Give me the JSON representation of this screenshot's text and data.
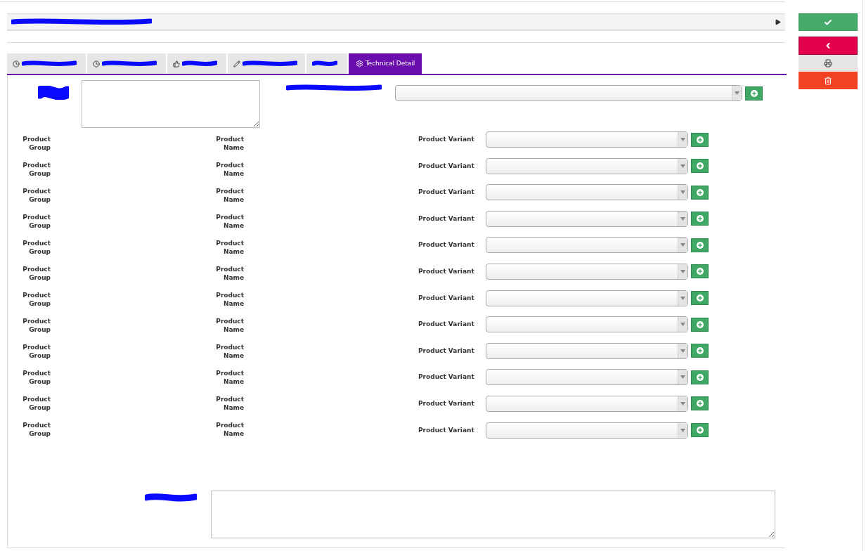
{
  "section_header": {
    "expanded": false
  },
  "tabs": [
    {
      "kind": "clock",
      "selected": false
    },
    {
      "kind": "clock",
      "selected": false
    },
    {
      "kind": "thumb",
      "selected": false
    },
    {
      "kind": "pencil",
      "selected": false
    },
    {
      "kind": "none",
      "selected": false
    },
    {
      "kind": "gear",
      "label": "Technical Detail",
      "selected": true
    }
  ],
  "group_labels": [
    {
      "line1": "Product",
      "line2": "Group"
    },
    {
      "line1": "Product",
      "line2": "Group"
    },
    {
      "line1": "Product",
      "line2": "Group"
    },
    {
      "line1": "Product",
      "line2": "Group"
    },
    {
      "line1": "Product",
      "line2": "Group"
    },
    {
      "line1": "Product",
      "line2": "Group"
    },
    {
      "line1": "Product",
      "line2": "Group"
    },
    {
      "line1": "Product",
      "line2": "Group"
    },
    {
      "line1": "Product",
      "line2": "Group"
    },
    {
      "line1": "Product",
      "line2": "Group"
    },
    {
      "line1": "Product",
      "line2": "Group"
    },
    {
      "line1": "Product",
      "line2": "Group"
    }
  ],
  "name_labels": [
    {
      "line1": "Product",
      "line2": "Name"
    },
    {
      "line1": "Product",
      "line2": "Name"
    },
    {
      "line1": "Product",
      "line2": "Name"
    },
    {
      "line1": "Product",
      "line2": "Name"
    },
    {
      "line1": "Product",
      "line2": "Name"
    },
    {
      "line1": "Product",
      "line2": "Name"
    },
    {
      "line1": "Product",
      "line2": "Name"
    },
    {
      "line1": "Product",
      "line2": "Name"
    },
    {
      "line1": "Product",
      "line2": "Name"
    },
    {
      "line1": "Product",
      "line2": "Name"
    },
    {
      "line1": "Product",
      "line2": "Name"
    },
    {
      "line1": "Product",
      "line2": "Name"
    }
  ],
  "variants": [
    "Product Variant",
    "Product Variant",
    "Product Variant",
    "Product Variant",
    "Product Variant",
    "Product Variant",
    "Product Variant",
    "Product Variant",
    "Product Variant",
    "Product Variant",
    "Product Variant",
    "Product Variant"
  ],
  "actions": [
    {
      "kind": "save"
    },
    {
      "kind": "back"
    },
    {
      "kind": "print"
    },
    {
      "kind": "delete"
    }
  ]
}
